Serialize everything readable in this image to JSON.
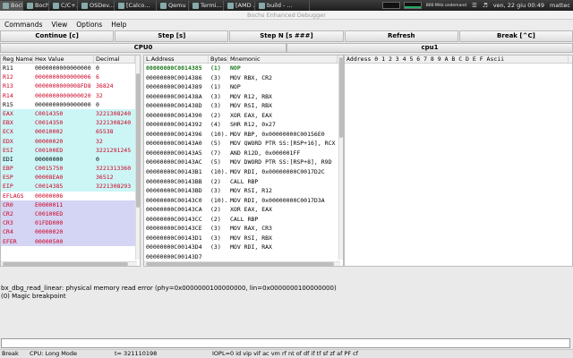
{
  "taskbar": {
    "items": [
      {
        "label": "Bochs..."
      },
      {
        "label": "Bochs..."
      },
      {
        "label": "C/C+..."
      },
      {
        "label": "OSDev..."
      },
      {
        "label": "[Calco..."
      },
      {
        "label": "Qemu ..."
      },
      {
        "label": "Termi..."
      },
      {
        "label": "[AMD ..."
      },
      {
        "label": "build - ..."
      }
    ],
    "cpu_freq": "800 MHz ondemand",
    "datetime": "ven, 22 giu   00:49",
    "user": "mattec"
  },
  "window": {
    "title": "Bochs Enhanced Debugger"
  },
  "menu": {
    "commands": "Commands",
    "view": "View",
    "options": "Options",
    "help": "Help"
  },
  "toolbar": {
    "continue": "Continue [c]",
    "step": "Step [s]",
    "step_n": "Step N [s ###]",
    "refresh": "Refresh",
    "break": "Break [^C]"
  },
  "cpu_tabs": {
    "cpu0": "CPU0",
    "cpu1": "cpu1"
  },
  "registers": {
    "headers": [
      "Reg Name",
      "Hex Value",
      "Decimal"
    ],
    "rows": [
      {
        "name": "R11",
        "hex": "0000000000000000",
        "dec": "0",
        "style": ""
      },
      {
        "name": "R12",
        "hex": "0000000000000006",
        "dec": "6",
        "style": "red"
      },
      {
        "name": "R13",
        "hex": "0000000000008FD8",
        "dec": "36824",
        "style": "red"
      },
      {
        "name": "R14",
        "hex": "0000000000000020",
        "dec": "32",
        "style": "red"
      },
      {
        "name": "R15",
        "hex": "0000000000000000",
        "dec": "0",
        "style": ""
      },
      {
        "name": "EAX",
        "hex": "C0014350",
        "dec": "3221308240",
        "style": "cyan red"
      },
      {
        "name": "EBX",
        "hex": "C0014350",
        "dec": "3221308240",
        "style": "cyan red"
      },
      {
        "name": "ECX",
        "hex": "00010002",
        "dec": "65538",
        "style": "cyan red"
      },
      {
        "name": "EDX",
        "hex": "00000020",
        "dec": "32",
        "style": "cyan red"
      },
      {
        "name": "ESI",
        "hex": "C00100ED",
        "dec": "3221291245",
        "style": "cyan red"
      },
      {
        "name": "EDI",
        "hex": "00000000",
        "dec": "0",
        "style": "cyan"
      },
      {
        "name": "EBP",
        "hex": "C0015750",
        "dec": "3221313360",
        "style": "cyan red"
      },
      {
        "name": "ESP",
        "hex": "00008EA0",
        "dec": "36512",
        "style": "cyan red"
      },
      {
        "name": "EIP",
        "hex": "C0014385",
        "dec": "3221308293",
        "style": "cyan red"
      },
      {
        "name": "EFLAGS",
        "hex": "00000006",
        "dec": "",
        "style": "red"
      },
      {
        "name": "CR0",
        "hex": "E0000011",
        "dec": "",
        "style": "lav red"
      },
      {
        "name": "CR2",
        "hex": "C00100ED",
        "dec": "",
        "style": "lav red"
      },
      {
        "name": "CR3",
        "hex": "01FDD000",
        "dec": "",
        "style": "lav red"
      },
      {
        "name": "CR4",
        "hex": "00000020",
        "dec": "",
        "style": "lav red"
      },
      {
        "name": "EFER",
        "hex": "00000500",
        "dec": "",
        "style": "lav red"
      }
    ]
  },
  "disasm": {
    "headers": [
      "L.Address",
      "Bytes",
      "Mnemonic"
    ],
    "rows": [
      {
        "addr": "00000000C0014385",
        "bytes": "(1)",
        "mnem": "NOP",
        "current": true
      },
      {
        "addr": "00000000C0014386",
        "bytes": "(3)",
        "mnem": "MOV RBX, CR2"
      },
      {
        "addr": "00000000C0014389",
        "bytes": "(1)",
        "mnem": "NOP"
      },
      {
        "addr": "00000000C001438A",
        "bytes": "(3)",
        "mnem": "MOV R12, RBX"
      },
      {
        "addr": "00000000C001438D",
        "bytes": "(3)",
        "mnem": "MOV RSI, RBX"
      },
      {
        "addr": "00000000C0014390",
        "bytes": "(2)",
        "mnem": "XOR EAX, EAX"
      },
      {
        "addr": "00000000C0014392",
        "bytes": "(4)",
        "mnem": "SHR R12, 0x27"
      },
      {
        "addr": "00000000C0014396",
        "bytes": "(10)...",
        "mnem": "MOV RBP, 0x00000000C00156E0"
      },
      {
        "addr": "00000000C00143A0",
        "bytes": "(5)",
        "mnem": "MOV QWORD PTR SS:[RSP+16], RCX"
      },
      {
        "addr": "00000000C00143A5",
        "bytes": "(7)",
        "mnem": "AND R12D, 0x000001FF"
      },
      {
        "addr": "00000000C00143AC",
        "bytes": "(5)",
        "mnem": "MOV DWORD PTR SS:[RSP+8], R9D"
      },
      {
        "addr": "00000000C00143B1",
        "bytes": "(10)...",
        "mnem": "MOV RDI, 0x00000000C0017D2C"
      },
      {
        "addr": "00000000C00143BB",
        "bytes": "(2)",
        "mnem": "CALL RBP"
      },
      {
        "addr": "00000000C00143BD",
        "bytes": "(3)",
        "mnem": "MOV RSI, R12"
      },
      {
        "addr": "00000000C00143C0",
        "bytes": "(10)...",
        "mnem": "MOV RDI, 0x00000000C0017D3A"
      },
      {
        "addr": "00000000C00143CA",
        "bytes": "(2)",
        "mnem": "XOR EAX, EAX"
      },
      {
        "addr": "00000000C00143CC",
        "bytes": "(2)",
        "mnem": "CALL RBP"
      },
      {
        "addr": "00000000C00143CE",
        "bytes": "(3)",
        "mnem": "MOV RAX, CR3"
      },
      {
        "addr": "00000000C00143D1",
        "bytes": "(3)",
        "mnem": "MOV RSI, RBX"
      },
      {
        "addr": "00000000C00143D4",
        "bytes": "(3)",
        "mnem": "MOV RDI, RAX"
      },
      {
        "addr": "00000000C00143D7",
        "bytes": "",
        "mnem": ""
      }
    ]
  },
  "memory": {
    "header": "Address  0  1  2  3  4  5  6  7  8  9  A  B  C  D  E  F  Ascii"
  },
  "output": {
    "lines": [
      "bx_dbg_read_linear: physical memory read error (phy=0x0000000100000000, lin=0x0000000100000000)",
      "(0) Magic breakpoint"
    ]
  },
  "command_input": {
    "value": ""
  },
  "status": {
    "state": "Break",
    "cpu_mode": "CPU: Long Mode",
    "ticks": "t=  321110198",
    "flags": "IOPL=0 id vip vif ac vm rf nt of df if tf sf zf af PF cf"
  }
}
